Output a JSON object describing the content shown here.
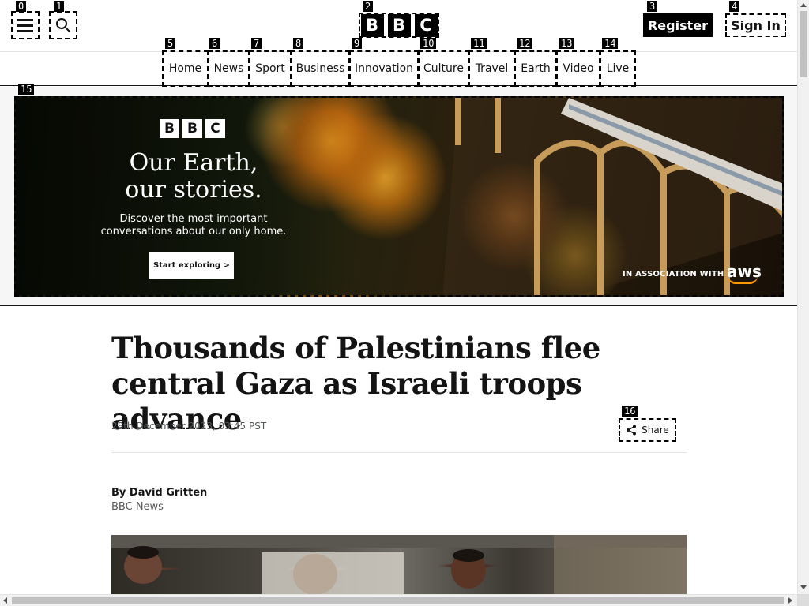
{
  "header": {
    "menu_icon": "hamburger-menu-icon",
    "search_icon": "search-icon",
    "logo": [
      "B",
      "B",
      "C"
    ],
    "register_label": "Register",
    "signin_label": "Sign In"
  },
  "nav": {
    "items": [
      {
        "label": "Home"
      },
      {
        "label": "News"
      },
      {
        "label": "Sport"
      },
      {
        "label": "Business"
      },
      {
        "label": "Innovation"
      },
      {
        "label": "Culture"
      },
      {
        "label": "Travel"
      },
      {
        "label": "Earth"
      },
      {
        "label": "Video"
      },
      {
        "label": "Live"
      }
    ]
  },
  "ad": {
    "logo": [
      "B",
      "B",
      "C"
    ],
    "title_line1": "Our Earth,",
    "title_line2": "our stories.",
    "subtitle_line1": "Discover the most important",
    "subtitle_line2": "conversations about our only home.",
    "cta_label": "Start exploring >",
    "association": "IN ASSOCIATION WITH",
    "sponsor": "aws"
  },
  "article": {
    "headline": "Thousands of Palestinians flee central Gaza as Israeli troops advance",
    "date": "28th December 2023, 03:45 PST",
    "share_label": "Share",
    "byline": "By David Gritten",
    "byline_org": "BBC News"
  },
  "labels": [
    "0",
    "1",
    "2",
    "3",
    "4",
    "5",
    "6",
    "7",
    "8",
    "9",
    "10",
    "11",
    "12",
    "13",
    "14",
    "15",
    "16"
  ],
  "colors": {
    "brand_black": "#000000",
    "text": "#141414",
    "muted": "#545658",
    "aws_orange": "#ff9900"
  }
}
